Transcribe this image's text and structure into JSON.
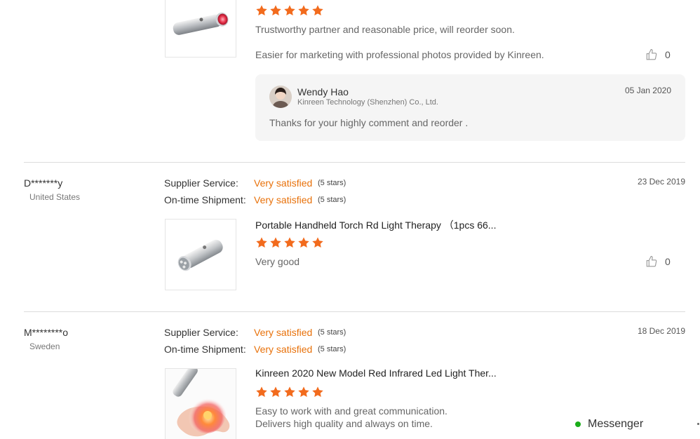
{
  "review1": {
    "comment1": "Trustworthy partner and reasonable price, will reorder soon.",
    "comment2": "Easier for marketing with professional photos provided by Kinreen.",
    "likes": "0",
    "reply": {
      "name": "Wendy Hao",
      "company": "Kinreen Technology (Shenzhen) Co., Ltd.",
      "date": "05 Jan 2020",
      "text": "Thanks for your highly comment and reorder ."
    }
  },
  "review2": {
    "reviewer": "D*******y",
    "country": "United States",
    "supplier_label": "Supplier Service:",
    "supplier_value": "Very satisfied",
    "supplier_stars": "(5 stars)",
    "shipment_label": "On-time Shipment:",
    "shipment_value": "Very satisfied",
    "shipment_stars": "(5 stars)",
    "date": "23 Dec 2019",
    "product": "Portable Handheld Torch Rd Light Therapy （1pcs 66...",
    "comment": "Very good",
    "likes": "0"
  },
  "review3": {
    "reviewer": "M********o",
    "country": "Sweden",
    "supplier_label": "Supplier Service:",
    "supplier_value": "Very satisfied",
    "supplier_stars": "(5 stars)",
    "shipment_label": "On-time Shipment:",
    "shipment_value": "Very satisfied",
    "shipment_stars": "(5 stars)",
    "date": "18 Dec 2019",
    "product": "Kinreen 2020 New Model Red Infrared Led Light Ther...",
    "comment1": "Easy to work with and great communication.",
    "comment2": "Delivers high quality and always on time."
  },
  "messenger": {
    "label": "Messenger"
  },
  "colors": {
    "accent": "#e8710a",
    "star": "#f26b1d",
    "online": "#1aad19"
  },
  "icons": {
    "star": "star-icon",
    "like": "thumbs-up-icon"
  }
}
